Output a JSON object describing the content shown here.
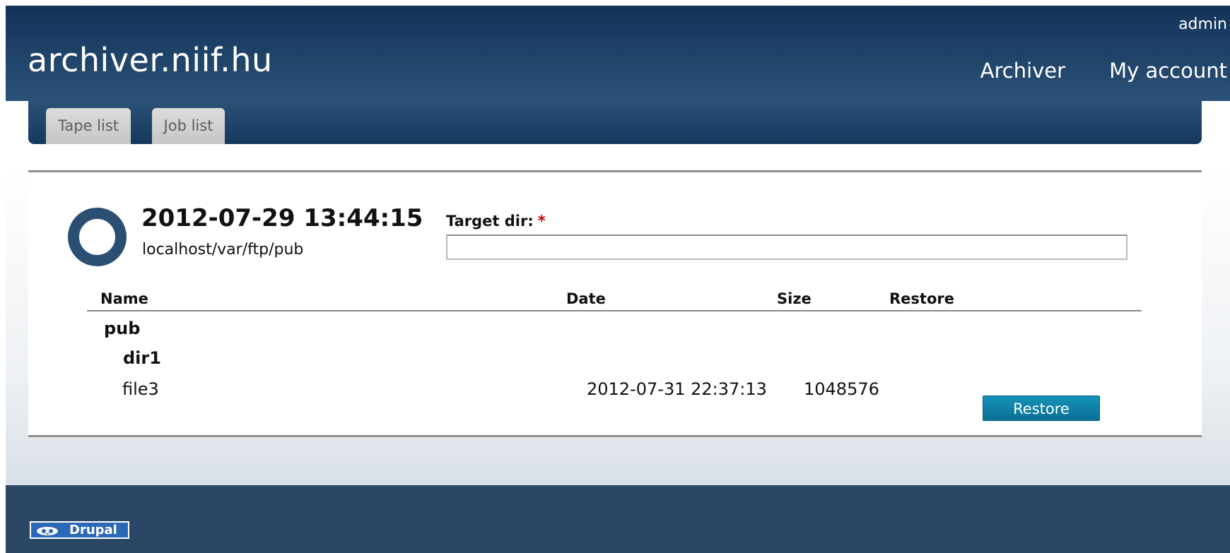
{
  "header": {
    "site_name": "archiver.niif.hu",
    "user": "admin",
    "menu": [
      "Archiver",
      "My account"
    ]
  },
  "tabs": [
    "Tape list",
    "Job list"
  ],
  "archive": {
    "date": "2012-07-29 13:44:15",
    "path": "localhost/var/ftp/pub"
  },
  "form": {
    "target_label": "Target dir:",
    "required_mark": "*",
    "target_value": ""
  },
  "table": {
    "columns": [
      "Name",
      "Date",
      "Size",
      "Restore"
    ],
    "rows": [
      {
        "name": "pub",
        "level": 0,
        "is_dir": true,
        "date": "",
        "size": "",
        "action": ""
      },
      {
        "name": "dir1",
        "level": 1,
        "is_dir": true,
        "date": "",
        "size": "",
        "action": ""
      },
      {
        "name": "file3",
        "level": 1,
        "is_dir": false,
        "date": "2012-07-31 22:37:13",
        "size": "1048576",
        "action": "Restore"
      }
    ]
  },
  "footer": {
    "badge_text": "Drupal"
  },
  "colors": {
    "header_dark": "#14335a",
    "header_light": "#2b5176",
    "footer": "#2a4766",
    "button": "#0a7fa6",
    "required": "#d00000"
  }
}
